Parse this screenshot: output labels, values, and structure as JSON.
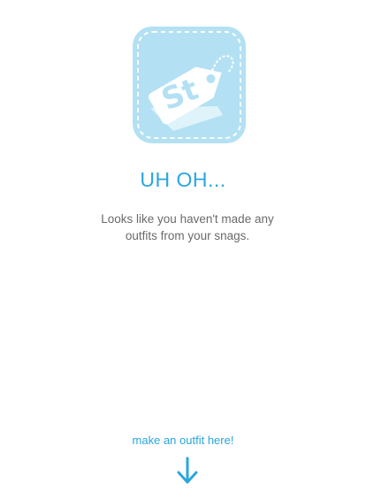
{
  "logo": {
    "text": "St",
    "icon": "price-tag-icon"
  },
  "empty_state": {
    "title": "UH OH...",
    "message": "Looks like you haven't made any outfits from your snags."
  },
  "cta": {
    "label": "make an outfit here!",
    "icon": "arrow-down-icon"
  },
  "colors": {
    "accent": "#2aa6df",
    "logo_bg": "#b3e1f3",
    "text_muted": "#6a6a6a"
  }
}
